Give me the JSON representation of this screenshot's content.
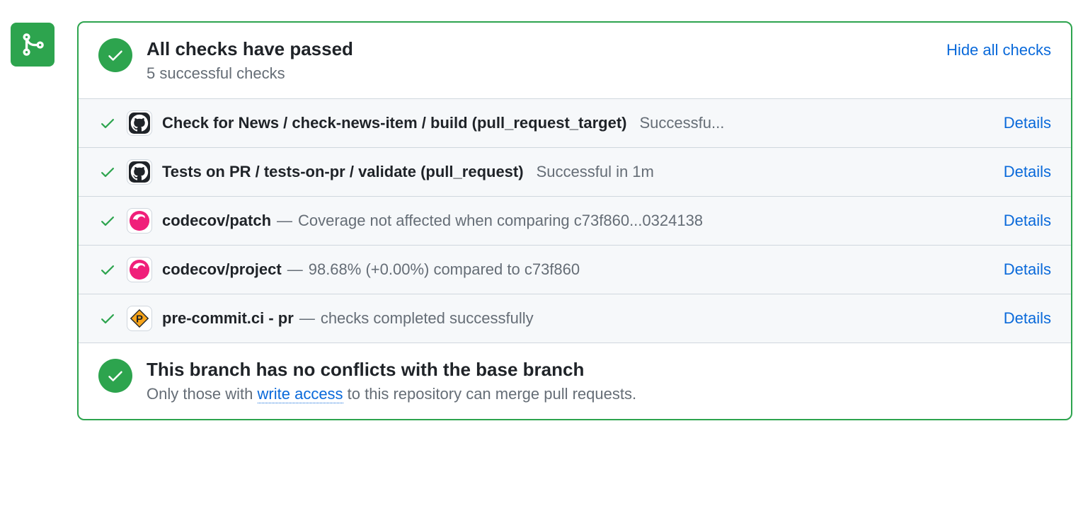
{
  "header": {
    "title": "All checks have passed",
    "subtitle": "5 successful checks",
    "toggle_label": "Hide all checks"
  },
  "checks": [
    {
      "icon": "github",
      "name": "Check for News / check-news-item / build (pull_request_target)",
      "sep": "",
      "detail": "",
      "status": "Successfu...",
      "details_label": "Details"
    },
    {
      "icon": "github",
      "name": "Tests on PR / tests-on-pr / validate (pull_request)",
      "sep": "",
      "detail": "",
      "status": "Successful in 1m",
      "details_label": "Details"
    },
    {
      "icon": "codecov",
      "name": "codecov/patch",
      "sep": "—",
      "detail": "Coverage not affected when comparing c73f860...0324138",
      "status": "",
      "details_label": "Details"
    },
    {
      "icon": "codecov",
      "name": "codecov/project",
      "sep": "—",
      "detail": "98.68% (+0.00%) compared to c73f860",
      "status": "",
      "details_label": "Details"
    },
    {
      "icon": "precommit",
      "name": "pre-commit.ci - pr",
      "sep": "—",
      "detail": "checks completed successfully",
      "status": "",
      "details_label": "Details"
    }
  ],
  "footer": {
    "title": "This branch has no conflicts with the base branch",
    "subtitle_pre": "Only those with ",
    "subtitle_link": "write access",
    "subtitle_post": " to this repository can merge pull requests."
  }
}
